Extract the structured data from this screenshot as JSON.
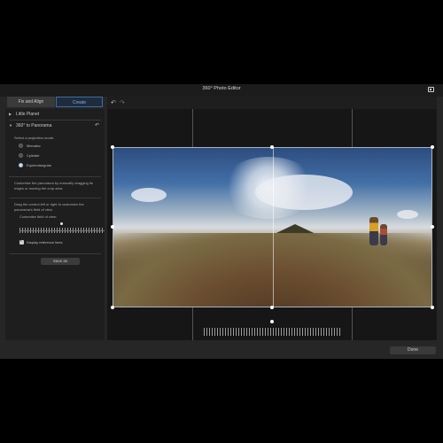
{
  "window": {
    "title": "360° Photo Editor"
  },
  "tabs": [
    {
      "label": "Fix and Align"
    },
    {
      "label": "Create"
    }
  ],
  "panel": {
    "little_planet": "Little Planet",
    "panorama": "360° to Panorama",
    "projection_prompt": "Select a projection mode:",
    "modes": [
      "Mercator",
      "Cylinder",
      "Equirectangular"
    ],
    "selected_mode": "Equirectangular",
    "crop_hint": "Customize the panorama by manually dragging its edges or moving the crop area.",
    "fov_hint": "Drag the control left or right to customize the panorama's field of view.",
    "fov_label": "Customize field of view:",
    "fov_level": 0.5,
    "display_lines": "Display reference lines",
    "display_lines_checked": true,
    "save_as": "Save as"
  },
  "toolbar": {
    "icons": [
      "undo-icon",
      "redo-icon"
    ]
  },
  "footer": {
    "done": "Done"
  }
}
